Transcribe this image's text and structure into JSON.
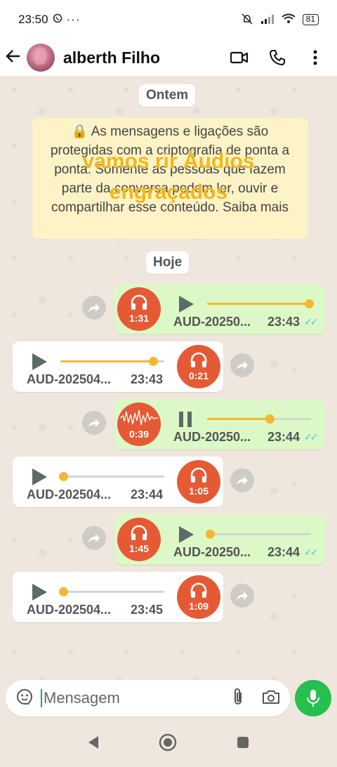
{
  "status_bar": {
    "time": "23:50",
    "dots": "···",
    "battery": "81"
  },
  "header": {
    "contact_name": "alberth Filho"
  },
  "chat": {
    "date_yesterday": "Ontem",
    "encryption_notice": "🔒 As mensagens e ligações são protegidas com a criptografia de ponta a ponta. Somente as pessoas que fazem parte da conversa podem ler, ouvir e compartilhar esse conteúdo. Saiba mais",
    "overlay_caption": "vamos rir Áudios engraçados",
    "date_today": "Hoje",
    "messages": [
      {
        "direction": "out",
        "duration": "1:31",
        "filename": "AUD-20250...",
        "time": "23:43",
        "state": "play",
        "progress": 1.0
      },
      {
        "direction": "in",
        "duration": "0:21",
        "filename": "AUD-202504...",
        "time": "23:43",
        "state": "play",
        "progress": 0.9
      },
      {
        "direction": "out",
        "duration": "0:39",
        "filename": "AUD-20250...",
        "time": "23:44",
        "state": "pause",
        "progress": 0.6
      },
      {
        "direction": "in",
        "duration": "1:05",
        "filename": "AUD-202504...",
        "time": "23:44",
        "state": "play",
        "progress": 0.0
      },
      {
        "direction": "out",
        "duration": "1:45",
        "filename": "AUD-20250...",
        "time": "23:44",
        "state": "play",
        "progress": 0.0
      },
      {
        "direction": "in",
        "duration": "1:09",
        "filename": "AUD-202504...",
        "time": "23:45",
        "state": "play",
        "progress": 0.0
      }
    ]
  },
  "composer": {
    "placeholder": "Mensagem"
  },
  "colors": {
    "outgoing_bubble": "#dcf8c6",
    "incoming_bubble": "#ffffff",
    "audio_avatar": "#e55a34",
    "progress": "#f5b730",
    "mic_button": "#25c04f",
    "read_ticks": "#53bdeb",
    "encryption_bg": "#fdf3c6"
  }
}
